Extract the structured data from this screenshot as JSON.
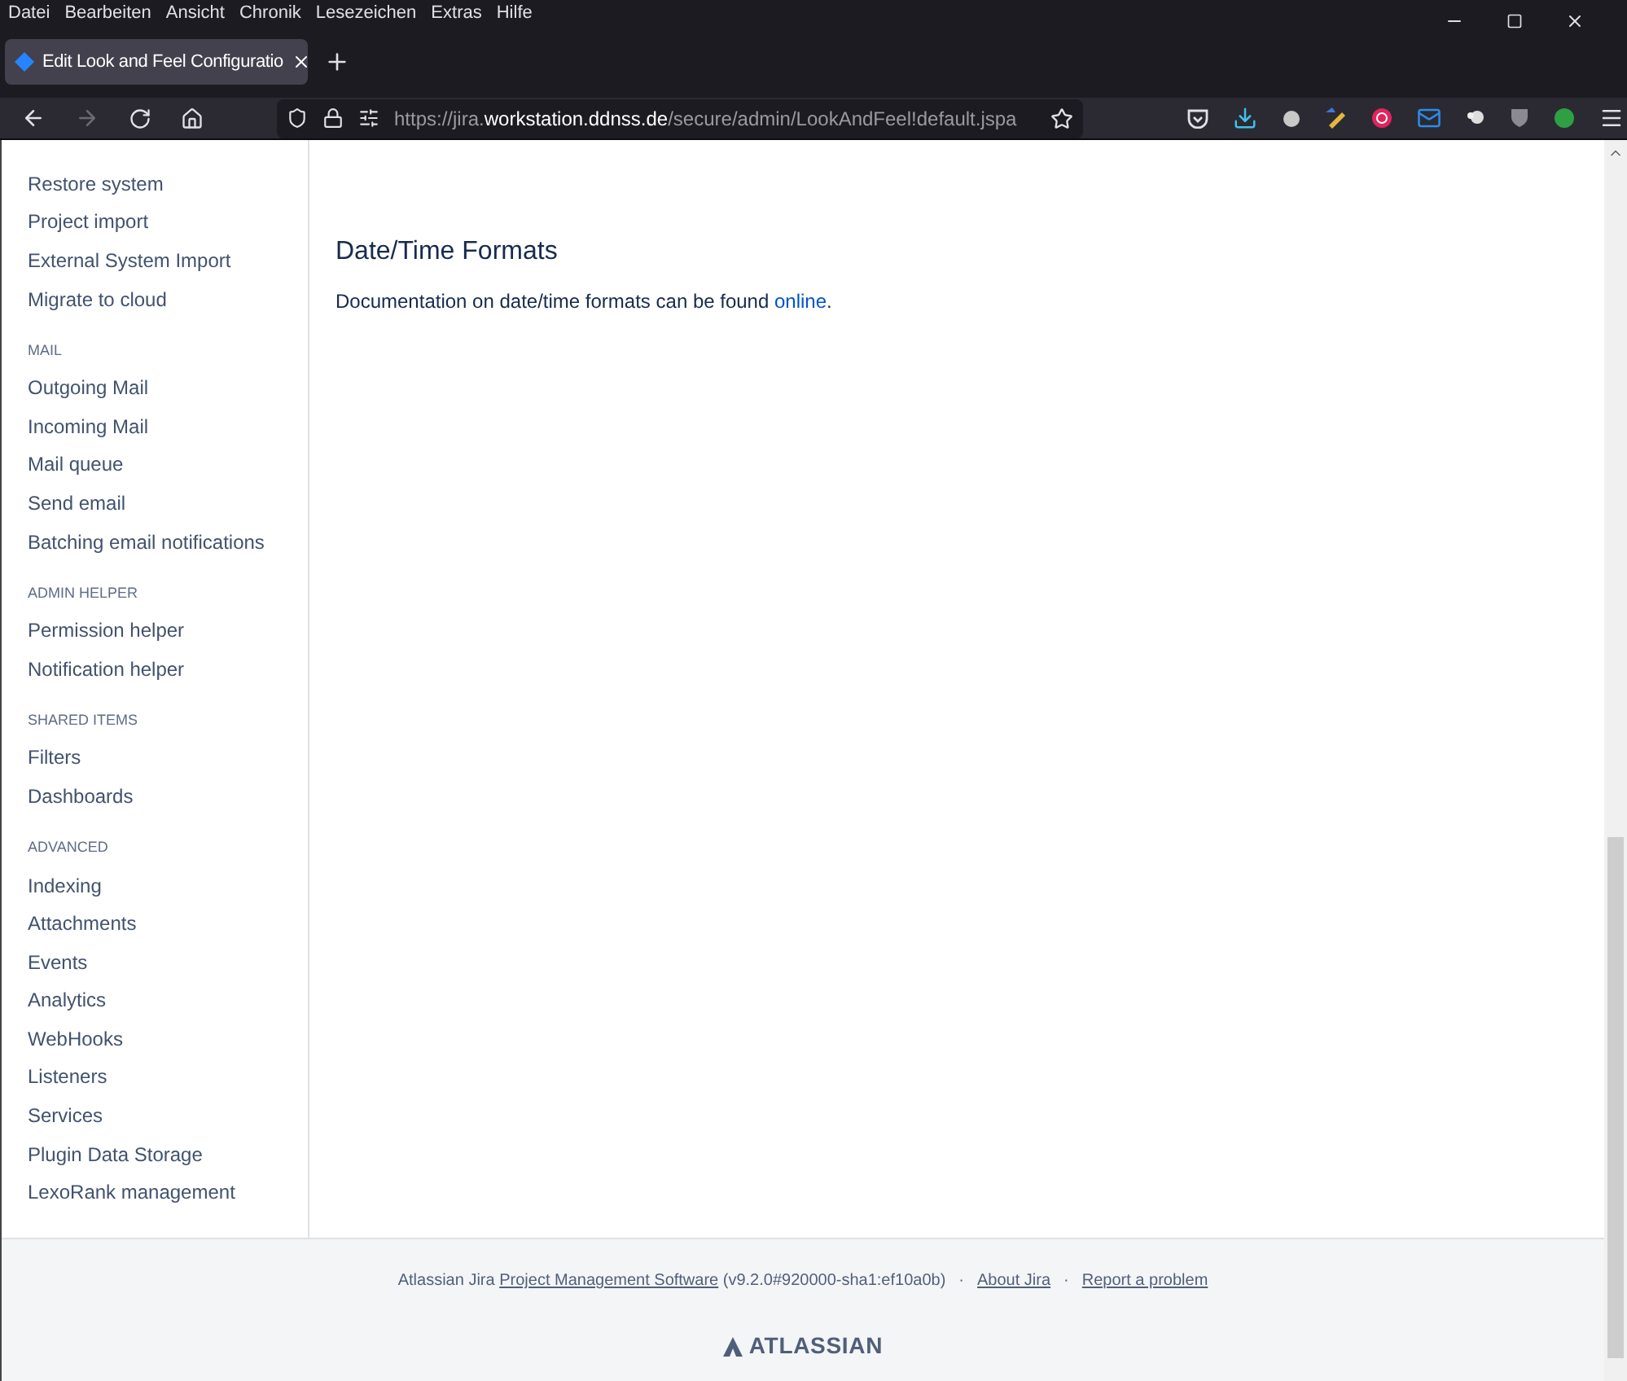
{
  "menu_bar": [
    "Datei",
    "Bearbeiten",
    "Ansicht",
    "Chronik",
    "Lesezeichen",
    "Extras",
    "Hilfe"
  ],
  "tabs": [
    {
      "label": "Edit Look and Feel Configuratio",
      "selected": true
    }
  ],
  "address_bar": {
    "prefix": "https://jira.",
    "domain": "workstation.ddnss.de",
    "path": "/secure/admin/LookAndFeel!default.jspa"
  },
  "sidebar": [
    {
      "items": [
        "Restore system",
        "Project import",
        "External System Import",
        "Migrate to cloud"
      ]
    },
    {
      "heading": "MAIL",
      "items": [
        "Outgoing Mail",
        "Incoming Mail",
        "Mail queue",
        "Send email",
        "Batching email notifications"
      ]
    },
    {
      "heading": "ADMIN HELPER",
      "items": [
        "Permission helper",
        "Notification helper"
      ]
    },
    {
      "heading": "SHARED ITEMS",
      "items": [
        "Filters",
        "Dashboards"
      ]
    },
    {
      "heading": "ADVANCED",
      "items": [
        "Indexing",
        "Attachments",
        "Events",
        "Analytics",
        "WebHooks",
        "Listeners",
        "Services",
        "Plugin Data Storage",
        "LexoRank management"
      ]
    }
  ],
  "main": {
    "heading": "Date/Time Formats",
    "text": "Documentation on date/time formats can be found",
    "link": "online",
    "after": "."
  },
  "footer": {
    "product": "Atlassian Jira",
    "product_link": "Project Management Software",
    "version": "(v9.2.0#920000-sha1:ef10a0b)",
    "links": [
      "About Jira",
      "Report a problem"
    ],
    "separator": "·",
    "logo": "ATLASSIAN"
  }
}
